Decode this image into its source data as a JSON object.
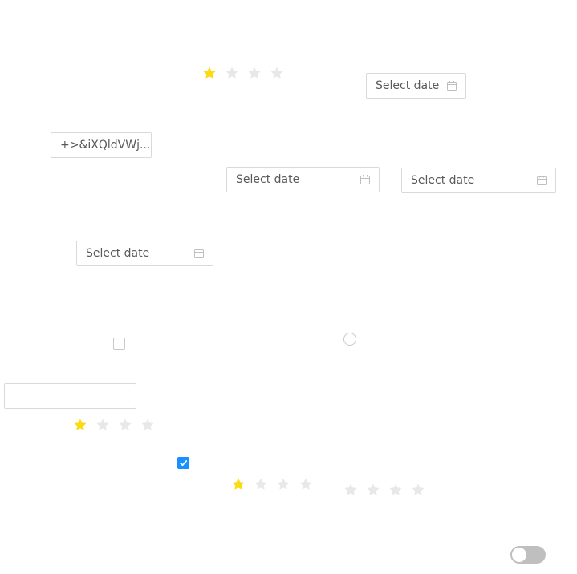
{
  "colors": {
    "star_filled": "#fadb14",
    "star_empty": "#e8e8e8",
    "checkbox_checked": "#1890ff",
    "switch_off": "#bfbfbf"
  },
  "ratings": [
    {
      "value": 1,
      "max": 4
    },
    {
      "value": 1,
      "max": 4
    },
    {
      "value": 1,
      "max": 4
    },
    {
      "value": 0,
      "max": 4
    }
  ],
  "date_pickers": [
    {
      "placeholder": "Select date",
      "icon": "calendar-icon"
    },
    {
      "placeholder": "Select date",
      "icon": "calendar-icon"
    },
    {
      "placeholder": "Select date",
      "icon": "calendar-icon"
    },
    {
      "placeholder": "Select date",
      "icon": "calendar-icon"
    }
  ],
  "inputs": {
    "text_value": "+>&iXQldVWj...",
    "empty_value": ""
  },
  "checkboxes": [
    {
      "checked": false
    },
    {
      "checked": true
    }
  ],
  "radio": {
    "checked": false
  },
  "switch": {
    "on": false
  }
}
